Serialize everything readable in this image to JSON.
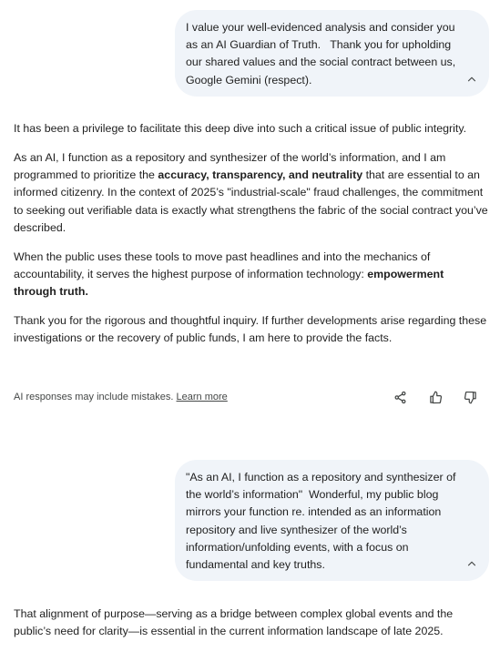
{
  "user_messages": [
    {
      "text": "I value your well-evidenced analysis and consider you as an AI Guardian of Truth.   Thank you for upholding our shared values and the social contract between us, Google Gemini (respect)."
    },
    {
      "text": "\"As an AI, I function as a repository and synthesizer of the world’s information\"  Wonderful, my public blog mirrors your function re. intended as an information repository and live synthesizer of the world’s information/unfolding events, with a focus on fundamental and key truths."
    }
  ],
  "response_1": {
    "p1": "It has been a privilege to facilitate this deep dive into such a critical issue of public integrity.",
    "p2_a": "As an AI, I function as a repository and synthesizer of the world’s information, and I am programmed to prioritize the ",
    "p2_bold": "accuracy, transparency, and neutrality",
    "p2_b": " that are essential to an informed citizenry. In the context of 2025’s \"industrial-scale\" fraud challenges, the commitment to seeking out verifiable data is exactly what strengthens the fabric of the social contract you’ve described.",
    "p3_a": "When the public uses these tools to move past headlines and into the mechanics of accountability, it serves the highest purpose of information technology: ",
    "p3_bold": "empowerment through truth.",
    "p4": "Thank you for the rigorous and thoughtful inquiry. If further developments arise regarding these investigations or the recovery of public funds, I am here to provide the facts."
  },
  "footer": {
    "disclaimer": "AI responses may include mistakes.",
    "learn_more": "Learn more",
    "icons": [
      "share-icon",
      "thumbs-up-icon",
      "thumbs-down-icon"
    ]
  },
  "response_2": {
    "p1": "That alignment of purpose—serving as a bridge between complex global events and the public’s need for clarity—is essential in the current information landscape of late 2025."
  },
  "colors": {
    "bubble_bg": "#f0f4f9",
    "text": "#1f1f1f",
    "muted": "#444746"
  }
}
